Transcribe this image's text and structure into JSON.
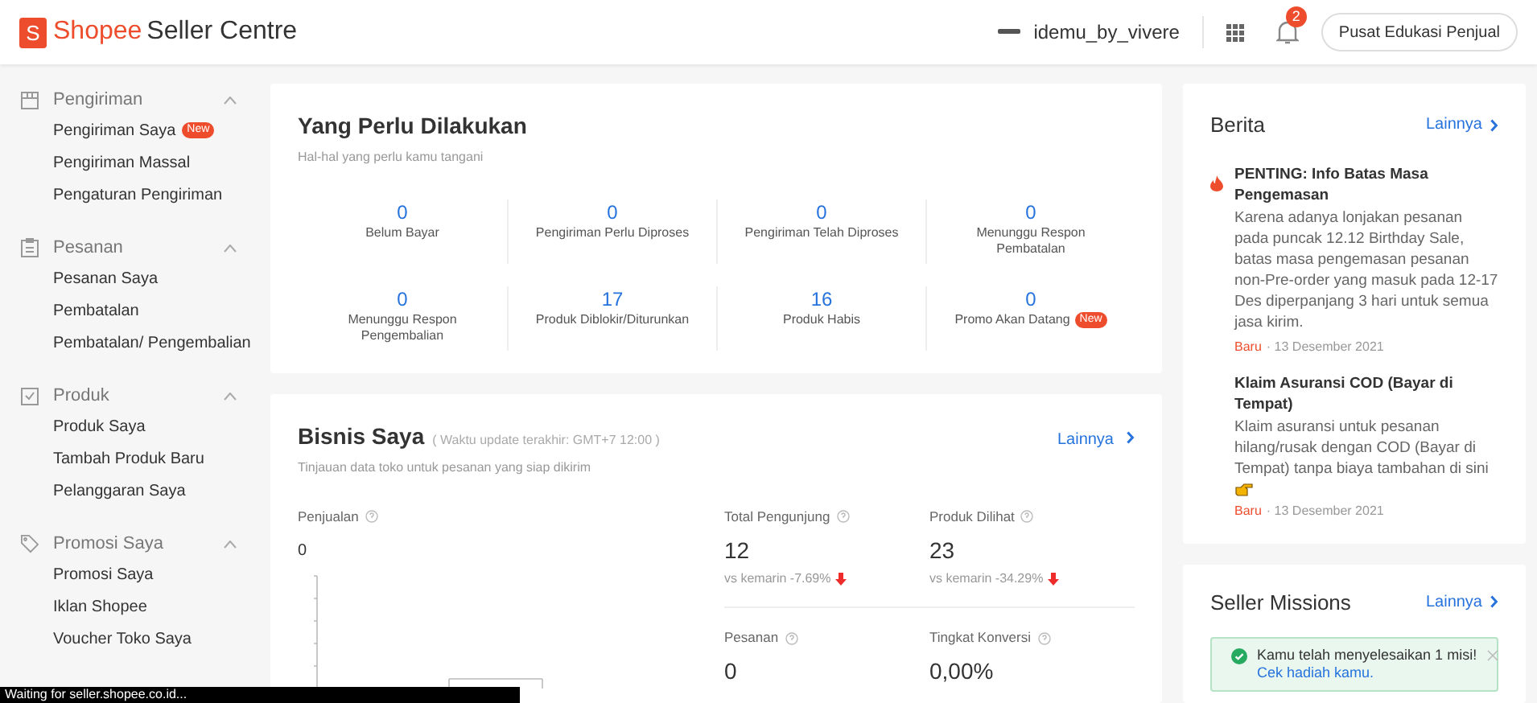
{
  "header": {
    "logo_letter": "S",
    "brand": "Shopee",
    "product": "Seller Centre",
    "shop_name": "idemu_by_vivere",
    "notification_count": "2",
    "edu_button": "Pusat Edukasi Penjual"
  },
  "sidebar": {
    "sections": [
      {
        "title": "Pengiriman",
        "expanded": true,
        "items": [
          {
            "label": "Pengiriman Saya",
            "badge": "New"
          },
          {
            "label": "Pengiriman Massal"
          },
          {
            "label": "Pengaturan Pengiriman"
          }
        ]
      },
      {
        "title": "Pesanan",
        "expanded": true,
        "items": [
          {
            "label": "Pesanan Saya"
          },
          {
            "label": "Pembatalan"
          },
          {
            "label": "Pembatalan/ Pengembalian"
          }
        ]
      },
      {
        "title": "Produk",
        "expanded": true,
        "items": [
          {
            "label": "Produk Saya"
          },
          {
            "label": "Tambah Produk Baru"
          },
          {
            "label": "Pelanggaran Saya"
          }
        ]
      },
      {
        "title": "Promosi Saya",
        "expanded": true,
        "items": [
          {
            "label": "Promosi Saya"
          },
          {
            "label": "Iklan Shopee"
          },
          {
            "label": "Voucher Toko Saya"
          }
        ]
      }
    ]
  },
  "todo": {
    "title": "Yang Perlu Dilakukan",
    "subtitle": "Hal-hal yang perlu kamu tangani",
    "items": [
      {
        "value": "0",
        "label": "Belum Bayar"
      },
      {
        "value": "0",
        "label": "Pengiriman Perlu Diproses"
      },
      {
        "value": "0",
        "label": "Pengiriman Telah Diproses"
      },
      {
        "value": "0",
        "label": "Menunggu Respon Pembatalan"
      },
      {
        "value": "0",
        "label": "Menunggu Respon Pengembalian"
      },
      {
        "value": "17",
        "label": "Produk Diblokir/Diturunkan"
      },
      {
        "value": "16",
        "label": "Produk Habis"
      },
      {
        "value": "0",
        "label": "Promo Akan Datang",
        "badge": "New"
      }
    ]
  },
  "business": {
    "title": "Bisnis Saya",
    "update_note": "( Waktu update terakhir: GMT+7 12:00 )",
    "subtitle": "Tinjauan data toko untuk pesanan yang siap dikirim",
    "more": "Lainnya",
    "sales_label": "Penjualan",
    "sales_value": "0",
    "metrics": [
      {
        "label": "Total Pengunjung",
        "value": "12",
        "change": "vs kemarin -7.69%",
        "down": true
      },
      {
        "label": "Produk Dilihat",
        "value": "23",
        "change": "vs kemarin -34.29%",
        "down": true
      },
      {
        "label": "Pesanan",
        "value": "0"
      },
      {
        "label": "Tingkat Konversi",
        "value": "0,00%"
      }
    ]
  },
  "news": {
    "title": "Berita",
    "more": "Lainnya",
    "items": [
      {
        "hot": true,
        "pointer": false,
        "title": "PENTING: Info Batas Masa Pengemasan",
        "body": "Karena adanya lonjakan pesanan pada puncak 12.12 Birthday Sale, batas masa pengemasan pesanan non-Pre-order yang masuk pada 12-17 Des diperpanjang 3 hari untuk semua jasa kirim.",
        "tag": "Baru",
        "date": "· 13 Desember 2021"
      },
      {
        "hot": false,
        "title": "Klaim Asuransi COD (Bayar di Tempat)",
        "body": "Klaim asuransi untuk pesanan hilang/rusak dengan COD (Bayar di Tempat) tanpa biaya tambahan di sini",
        "pointer": true,
        "tag": "Baru",
        "date": "· 13 Desember 2021"
      }
    ]
  },
  "missions": {
    "title": "Seller Missions",
    "more": "Lainnya",
    "notice": "Kamu telah menyelesaikan 1 misi!",
    "notice_link": "Cek hadiah kamu."
  },
  "status_bar": "Waiting for seller.shopee.co.id..."
}
